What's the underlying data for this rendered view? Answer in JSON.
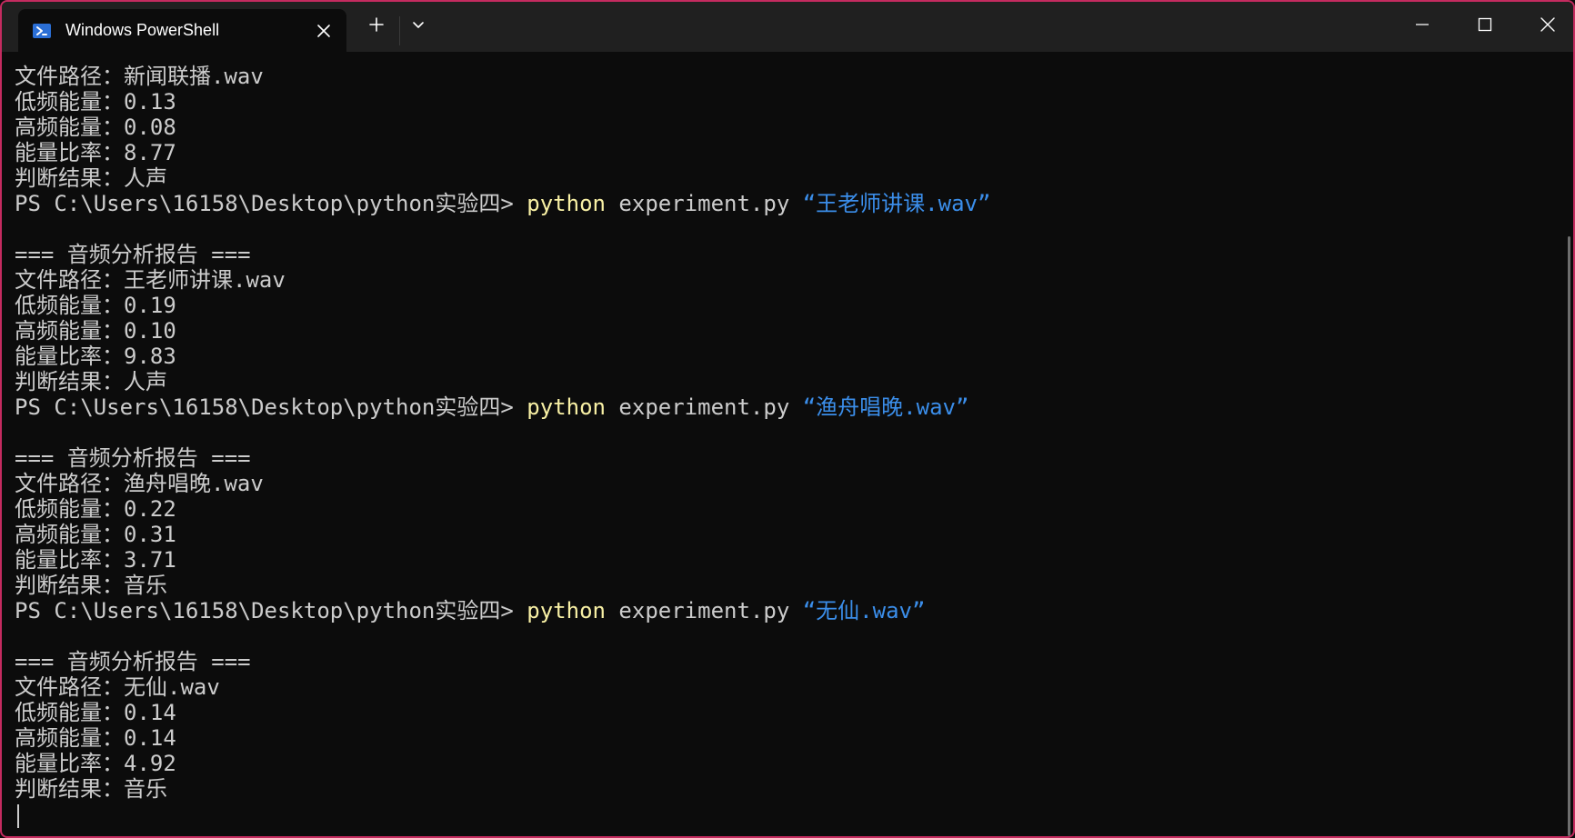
{
  "window": {
    "tab_title": "Windows PowerShell",
    "icons": {
      "tab": "powershell-icon",
      "close_tab": "close-icon",
      "new_tab": "plus-icon",
      "dropdown": "chevron-down-icon",
      "minimize": "minimize-icon",
      "maximize": "maximize-icon",
      "close_window": "close-icon"
    }
  },
  "terminal": {
    "colors": {
      "background": "#0c0c0c",
      "text": "#cccccc",
      "command": "#f9f1a5",
      "string": "#3b8eea",
      "border": "#c42b5f"
    },
    "lines": [
      {
        "text": "文件路径：新闻联播.wav"
      },
      {
        "text": "低频能量：0.13"
      },
      {
        "text": "高频能量：0.08"
      },
      {
        "text": "能量比率：8.77"
      },
      {
        "text": "判断结果：人声"
      },
      {
        "prompt": "PS C:\\Users\\16158\\Desktop\\python实验四> ",
        "cmd": "python",
        "args": " experiment.py ",
        "string": "“王老师讲课.wav”"
      },
      {
        "text": ""
      },
      {
        "text": "=== 音频分析报告 ==="
      },
      {
        "text": "文件路径：王老师讲课.wav"
      },
      {
        "text": "低频能量：0.19"
      },
      {
        "text": "高频能量：0.10"
      },
      {
        "text": "能量比率：9.83"
      },
      {
        "text": "判断结果：人声"
      },
      {
        "prompt": "PS C:\\Users\\16158\\Desktop\\python实验四> ",
        "cmd": "python",
        "args": " experiment.py ",
        "string": "“渔舟唱晚.wav”"
      },
      {
        "text": ""
      },
      {
        "text": "=== 音频分析报告 ==="
      },
      {
        "text": "文件路径：渔舟唱晚.wav"
      },
      {
        "text": "低频能量：0.22"
      },
      {
        "text": "高频能量：0.31"
      },
      {
        "text": "能量比率：3.71"
      },
      {
        "text": "判断结果：音乐"
      },
      {
        "prompt": "PS C:\\Users\\16158\\Desktop\\python实验四> ",
        "cmd": "python",
        "args": " experiment.py ",
        "string": "“无仙.wav”"
      },
      {
        "text": ""
      },
      {
        "text": "=== 音频分析报告 ==="
      },
      {
        "text": "文件路径：无仙.wav"
      },
      {
        "text": "低频能量：0.14"
      },
      {
        "text": "高频能量：0.14"
      },
      {
        "text": "能量比率：4.92"
      },
      {
        "text": "判断结果：音乐"
      }
    ]
  }
}
